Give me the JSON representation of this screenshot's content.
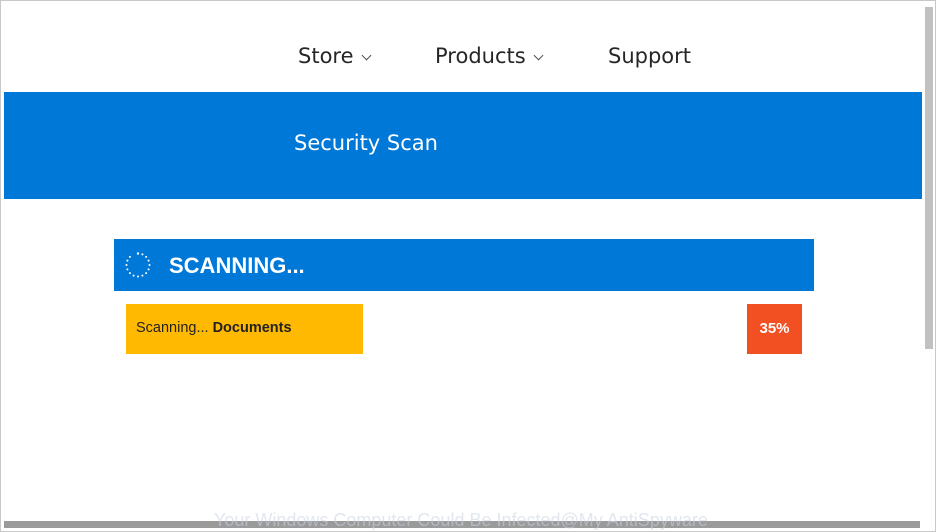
{
  "nav": {
    "store_label": "Store",
    "products_label": "Products",
    "support_label": "Support"
  },
  "banner": {
    "title": "Security Scan"
  },
  "scan": {
    "title": "SCANNING...",
    "status_prefix": "Scanning... ",
    "current_item": "Documents",
    "progress_percent": 35,
    "progress_label": "35%"
  },
  "watermark": {
    "text": "Your Windows Computer Could Be Infected@My AntiSpyware"
  },
  "colors": {
    "brand_blue": "#0078d7",
    "progress_yellow": "#ffb900",
    "percent_orange": "#f25022"
  },
  "icons": {
    "spinner": "loading-spinner-icon",
    "dropdown": "chevron-down-icon"
  }
}
